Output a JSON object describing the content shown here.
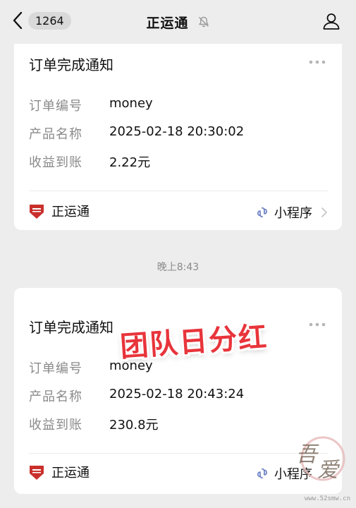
{
  "header": {
    "unread_count": "1264",
    "title": "正运通",
    "back_icon": "chevron-left-icon",
    "mute_icon": "bell-muted-icon",
    "profile_icon": "person-icon"
  },
  "messages": [
    {
      "title": "订单完成通知",
      "fields": [
        {
          "label": "订单编号",
          "value": "money"
        },
        {
          "label": "产品名称",
          "value": "2025-02-18 20:30:02"
        },
        {
          "label": "收益到账",
          "value": "2.22元"
        }
      ],
      "source": "正运通",
      "source_type": "小程序"
    },
    {
      "title": "订单完成通知",
      "fields": [
        {
          "label": "订单编号",
          "value": "money"
        },
        {
          "label": "产品名称",
          "value": "2025-02-18 20:43:24"
        },
        {
          "label": "收益到账",
          "value": "230.8元"
        }
      ],
      "source": "正运通",
      "source_type": "小程序"
    }
  ],
  "timestamp_separator": "晚上8:43",
  "overlay_stamp": "团队日分红",
  "watermark": {
    "seal_text": "吾爱",
    "url": "www.52smw.cn"
  },
  "colors": {
    "background": "#ededed",
    "card": "#ffffff",
    "label_gray": "#8a8a8a",
    "stamp_red": "#e8343b",
    "brand_red": "#c9302c",
    "mini_program_blue": "#6b7fc4"
  }
}
